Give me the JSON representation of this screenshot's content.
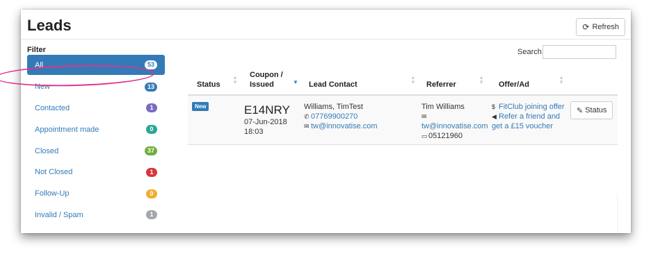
{
  "header": {
    "title": "Leads",
    "refresh_label": "Refresh"
  },
  "filter": {
    "label": "Filter",
    "items": [
      {
        "label": "All",
        "count": "53",
        "color": "#ffffff",
        "active": true
      },
      {
        "label": "New",
        "count": "13",
        "color": "#337ab7"
      },
      {
        "label": "Contacted",
        "count": "1",
        "color": "#7b6bc4"
      },
      {
        "label": "Appointment made",
        "count": "0",
        "color": "#2aa890"
      },
      {
        "label": "Closed",
        "count": "37",
        "color": "#6fae3a"
      },
      {
        "label": "Not Closed",
        "count": "1",
        "color": "#d9363e"
      },
      {
        "label": "Follow-Up",
        "count": "0",
        "color": "#f0ad2f"
      },
      {
        "label": "Invalid / Spam",
        "count": "1",
        "color": "#a3a7ad"
      }
    ]
  },
  "search": {
    "label": "Search:",
    "value": ""
  },
  "table": {
    "columns": {
      "status": "Status",
      "coupon_1": "Coupon /",
      "coupon_2": "Issued",
      "lead_contact": "Lead Contact",
      "referrer": "Referrer",
      "offer": "Offer/Ad"
    },
    "rows": [
      {
        "status": "New",
        "coupon_code": "E14NRY",
        "coupon_date": "07-Jun-2018",
        "coupon_time": "18:03",
        "lead_name": "Williams, TimTest",
        "lead_phone": "07769900270",
        "lead_email": "tw@innovatise.com",
        "ref_name": "Tim Williams",
        "ref_email": "tw@innovatise.com",
        "ref_date": "05121960",
        "offer_1": "FitClub joining offer",
        "offer_2a": "Refer a friend and",
        "offer_2b": "get a £15 voucher",
        "action_label": "Status"
      }
    ]
  },
  "icons": {
    "refresh": "refresh-icon",
    "phone": "phone-icon",
    "envelope": "envelope-icon",
    "calendar": "calendar-icon",
    "dollar": "dollar-icon",
    "bullhorn": "bullhorn-icon",
    "pencil": "pencil-icon"
  },
  "colors": {
    "accent": "#337ab7",
    "annotation": "#e0338f"
  }
}
